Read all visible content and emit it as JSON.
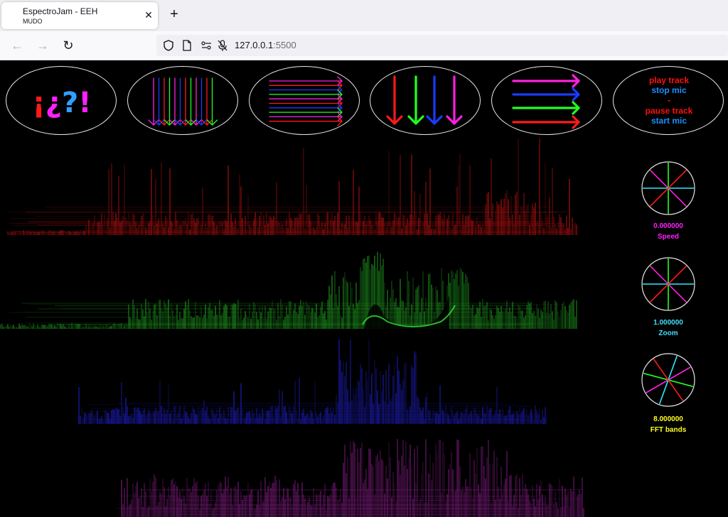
{
  "browser": {
    "tab_title": "EspectroJam - EEH",
    "tab_subtitle": "MUDO",
    "close_glyph": "✕",
    "new_tab_glyph": "+",
    "url_host": "127.0.0.1",
    "url_port": ":5500",
    "back_glyph": "←",
    "forward_glyph": "→",
    "reload_glyph": "↻"
  },
  "toolbar": {
    "help_text": "¡¿?!",
    "track_lines": [
      "play track",
      "stop mic",
      "-",
      "pause track",
      "start mic"
    ],
    "track_colors": [
      "#ff1010",
      "#1a8fff",
      "#ff1010",
      "#ff1010",
      "#1a8fff"
    ]
  },
  "controls": {
    "speed": {
      "value": "0.000000",
      "label": "Speed",
      "color": "#ff20ff"
    },
    "zoom": {
      "value": "1.000000",
      "label": "Zoom",
      "color": "#40e0ff"
    },
    "fft": {
      "value": "8.000000",
      "label": "FFT bands",
      "color": "#ffff20"
    }
  },
  "colors": {
    "red": "#ff1a1a",
    "green": "#20ff20",
    "blue": "#1a3bff",
    "magenta": "#ff20e0",
    "cyan": "#30e8ff"
  }
}
